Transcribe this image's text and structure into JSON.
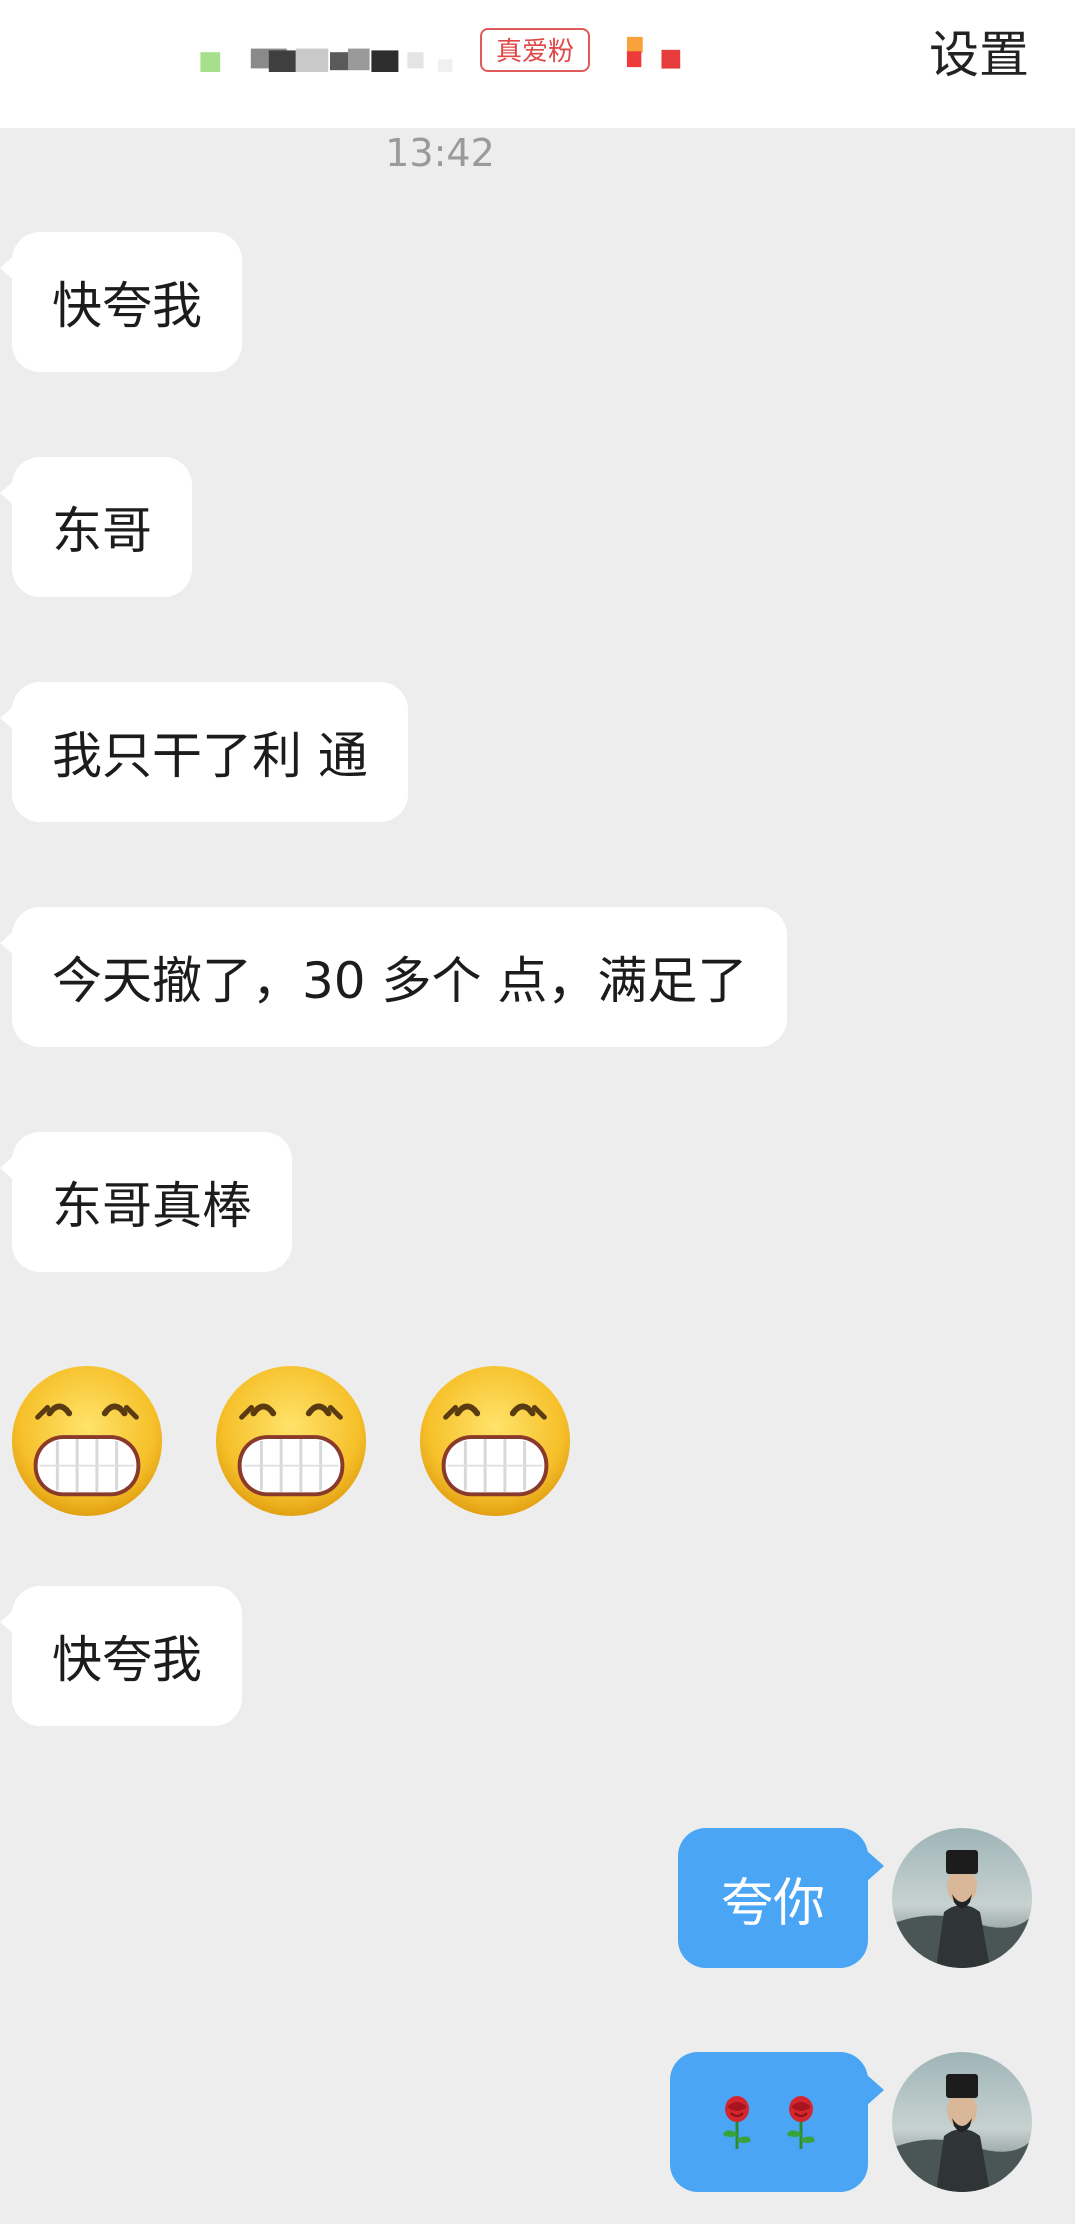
{
  "header": {
    "fan_badge": "真爱粉",
    "settings_label": "设置"
  },
  "timestamp": "13:42",
  "incoming_messages": [
    {
      "text": "快夸我"
    },
    {
      "text": "东哥"
    },
    {
      "text": "我只干了利 通"
    },
    {
      "text": "今天撤了，30 多个 点，满足了"
    },
    {
      "text": "东哥真棒"
    },
    {
      "text": "快夸我"
    }
  ],
  "emoji_row": {
    "icons": [
      "grinning-face-icon",
      "grinning-face-icon",
      "grinning-face-icon"
    ]
  },
  "outgoing_messages": [
    {
      "text": "夸你"
    },
    {
      "icons": [
        "rose-icon",
        "rose-icon"
      ]
    }
  ],
  "colors": {
    "background": "#ededed",
    "incoming_bubble": "#ffffff",
    "outgoing_bubble": "#4aa5f5",
    "badge": "#e04848"
  }
}
